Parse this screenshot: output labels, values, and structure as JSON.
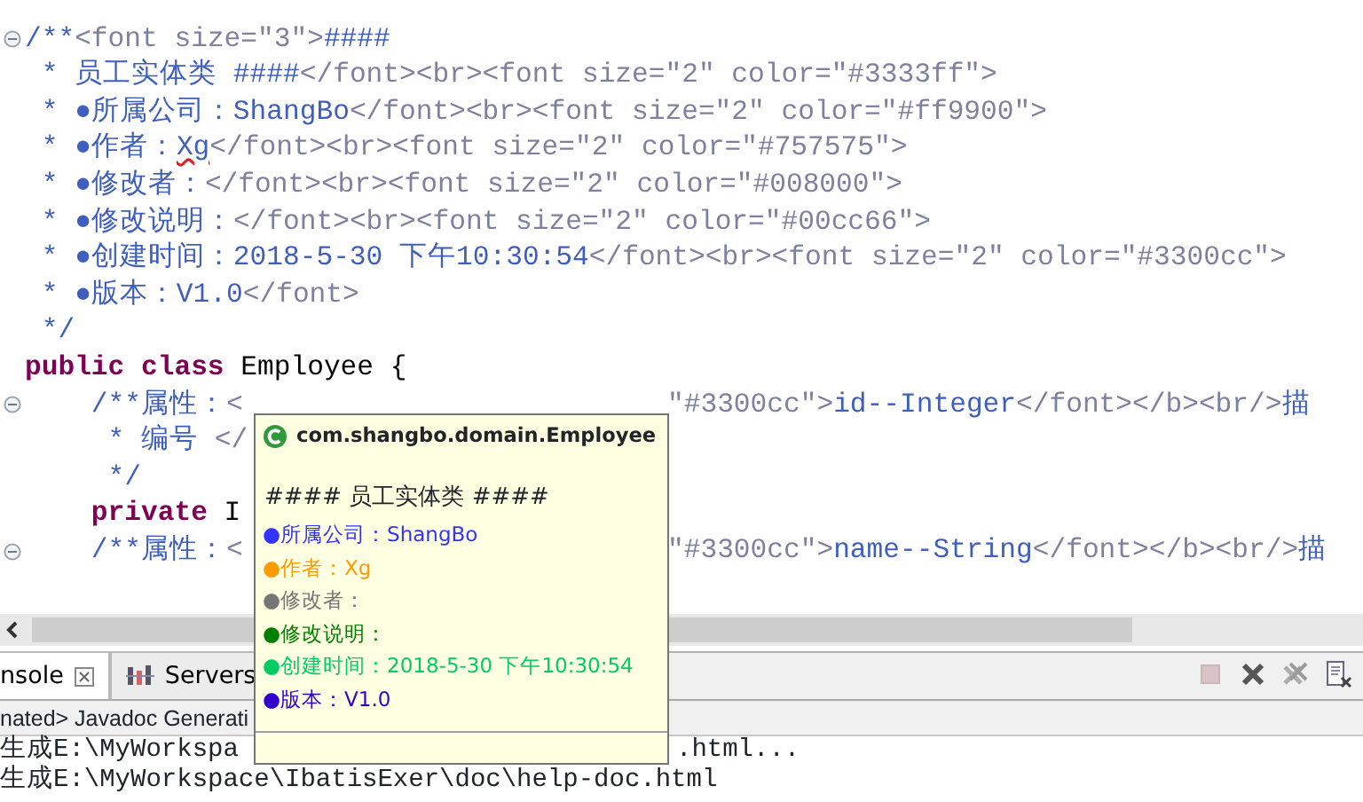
{
  "editor": {
    "lines": [
      {
        "fold": true,
        "tokens": [
          {
            "kind": "doc",
            "text": "/**"
          },
          {
            "kind": "tag",
            "text": "<font size=\"3\">"
          },
          {
            "kind": "doc",
            "text": "####"
          }
        ]
      },
      {
        "fold": false,
        "tokens": [
          {
            "kind": "doc",
            "text": " * 员工实体类 ####"
          },
          {
            "kind": "tag",
            "text": "</font><br><font size=\"2\" color=\"#3333ff\">"
          }
        ]
      },
      {
        "fold": false,
        "tokens": [
          {
            "kind": "doc",
            "text": " * ●所属公司：ShangBo"
          },
          {
            "kind": "tag",
            "text": "</font><br><font size=\"2\" color=\"#ff9900\">"
          }
        ]
      },
      {
        "fold": false,
        "tokens": [
          {
            "kind": "doc",
            "text": " * ●作者："
          },
          {
            "kind": "misspelled",
            "text": "Xg"
          },
          {
            "kind": "tag",
            "text": "</font><br><font size=\"2\" color=\"#757575\">"
          }
        ]
      },
      {
        "fold": false,
        "tokens": [
          {
            "kind": "doc",
            "text": " * ●修改者："
          },
          {
            "kind": "tag",
            "text": "</font><br><font size=\"2\" color=\"#008000\">"
          }
        ]
      },
      {
        "fold": false,
        "tokens": [
          {
            "kind": "doc",
            "text": " * ●修改说明："
          },
          {
            "kind": "tag",
            "text": "</font><br><font size=\"2\" color=\"#00cc66\">"
          }
        ]
      },
      {
        "fold": false,
        "tokens": [
          {
            "kind": "doc",
            "text": " * ●创建时间：2018-5-30 下午10:30:54"
          },
          {
            "kind": "tag",
            "text": "</font><br><font size=\"2\" color=\"#3300cc\">"
          }
        ]
      },
      {
        "fold": false,
        "tokens": [
          {
            "kind": "doc",
            "text": " * ●版本：V1.0"
          },
          {
            "kind": "tag",
            "text": "</font>"
          }
        ]
      },
      {
        "fold": false,
        "tokens": [
          {
            "kind": "doc",
            "text": " */"
          }
        ]
      },
      {
        "fold": false,
        "tokens": [
          {
            "kind": "keyword",
            "text": "public class"
          },
          {
            "kind": "plain",
            "text": " Employee {"
          }
        ]
      },
      {
        "fold": true,
        "tokens": [
          {
            "kind": "doc",
            "text": "    /**属性："
          },
          {
            "kind": "tag",
            "text": "<"
          }
        ],
        "right": [
          {
            "kind": "tag",
            "text": "\"#3300cc\">"
          },
          {
            "kind": "doc",
            "text": "id--Integer"
          },
          {
            "kind": "tag",
            "text": "</font></b><br/>"
          },
          {
            "kind": "doc",
            "text": "描"
          }
        ]
      },
      {
        "fold": false,
        "tokens": [
          {
            "kind": "doc",
            "text": "     * 编号 "
          },
          {
            "kind": "tag",
            "text": "</"
          }
        ]
      },
      {
        "fold": false,
        "tokens": [
          {
            "kind": "doc",
            "text": "     */"
          }
        ]
      },
      {
        "fold": false,
        "tokens": [
          {
            "kind": "keyword",
            "text": "    private"
          },
          {
            "kind": "plain",
            "text": " I"
          }
        ]
      },
      {
        "fold": true,
        "tokens": [
          {
            "kind": "doc",
            "text": "    /**属性："
          },
          {
            "kind": "tag",
            "text": "<"
          }
        ],
        "right": [
          {
            "kind": "tag",
            "text": "\"#3300cc\">"
          },
          {
            "kind": "doc",
            "text": "name--String"
          },
          {
            "kind": "tag",
            "text": "</font></b><br/>"
          },
          {
            "kind": "doc",
            "text": "描"
          }
        ]
      }
    ]
  },
  "popup": {
    "title": "com.shangbo.domain.Employee",
    "heading": "#### 员工实体类 ####",
    "items": [
      {
        "text": "●所属公司：ShangBo",
        "color": "#3333ff"
      },
      {
        "text": "●作者：Xg",
        "color": "#ff9900"
      },
      {
        "text": "●修改者：",
        "color": "#757575"
      },
      {
        "text": "●修改说明：",
        "color": "#008000"
      },
      {
        "text": "●创建时间：2018-5-30 下午10:30:54",
        "color": "#00cc66"
      },
      {
        "text": "●版本：V1.0",
        "color": "#3300cc"
      }
    ]
  },
  "panel": {
    "tabs": [
      {
        "label": "nsole",
        "selected": true
      },
      {
        "label": "Servers",
        "selected": false
      }
    ],
    "toolbar": [
      {
        "kind": "stop",
        "disabled": true
      },
      {
        "kind": "remove",
        "disabled": false
      },
      {
        "kind": "remove-all",
        "disabled": true
      },
      {
        "kind": "clear",
        "disabled": false
      }
    ],
    "process": "nated> Javadoc Generati",
    "console": [
      {
        "text": "生成E:\\MyWorkspa",
        "right": ".html..."
      },
      {
        "text": "生成E:\\MyWorkspace\\IbatisExer\\doc\\help-doc.html"
      }
    ]
  }
}
